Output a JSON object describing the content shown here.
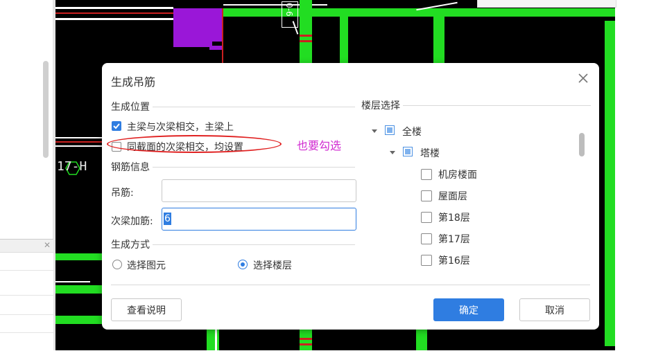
{
  "cad": {
    "axis_label": "17-H",
    "vertical_label": "0-6"
  },
  "dialog": {
    "title": "生成吊筋",
    "generate_position": {
      "section_title": "生成位置",
      "opt1_label": "主梁与次梁相交，主梁上",
      "opt1_checked": true,
      "opt2_label": "同截面的次梁相交，均设置",
      "opt2_checked": false
    },
    "rebar_info": {
      "section_title": "钢筋信息",
      "hanger_label": "吊筋:",
      "hanger_value": "",
      "secondary_label": "次梁加筋:",
      "secondary_value": "6"
    },
    "generate_method": {
      "section_title": "生成方式",
      "radio1_label": "选择图元",
      "radio1_selected": false,
      "radio2_label": "选择楼层",
      "radio2_selected": true
    },
    "floor_select": {
      "section_title": "楼层选择",
      "root": "全楼",
      "group": "塔楼",
      "floors": [
        "机房楼面",
        "屋面层",
        "第18层",
        "第17层",
        "第16层"
      ]
    },
    "buttons": {
      "help": "查看说明",
      "ok": "确定",
      "cancel": "取消"
    }
  },
  "annotation": {
    "note": "也要勾选"
  },
  "colors": {
    "accent": "#2f7de1",
    "cad_green": "#22dd22",
    "annotation_red": "#e02020",
    "annotation_text": "#d12ad1"
  }
}
